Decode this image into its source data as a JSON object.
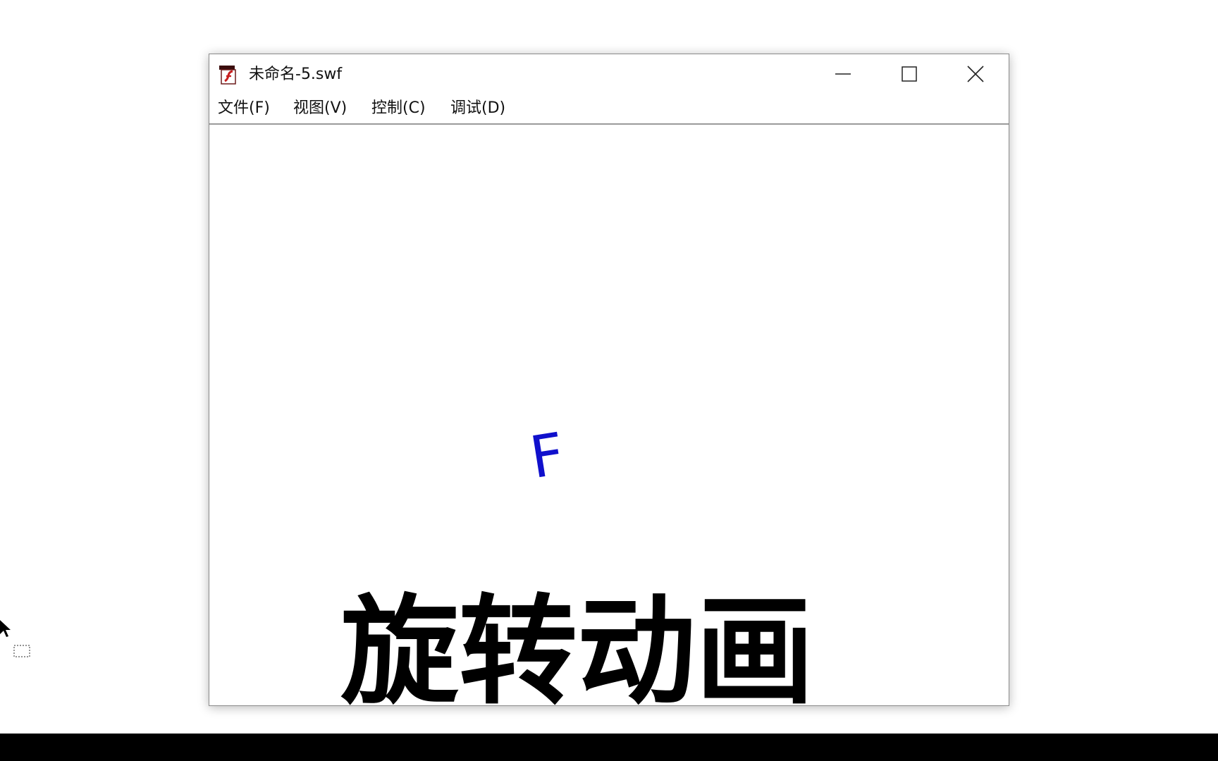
{
  "window": {
    "title": "未命名-5.swf",
    "icon": "flash-player-icon"
  },
  "menu": {
    "items": [
      {
        "label": "文件(F)"
      },
      {
        "label": "视图(V)"
      },
      {
        "label": "控制(C)"
      },
      {
        "label": "调试(D)"
      }
    ]
  },
  "stage": {
    "glyph": "F",
    "glyph_color": "#1010cc",
    "caption": "旋转动画"
  },
  "colors": {
    "bottom_bar": "#000000",
    "window_border": "#8a8a8a"
  }
}
